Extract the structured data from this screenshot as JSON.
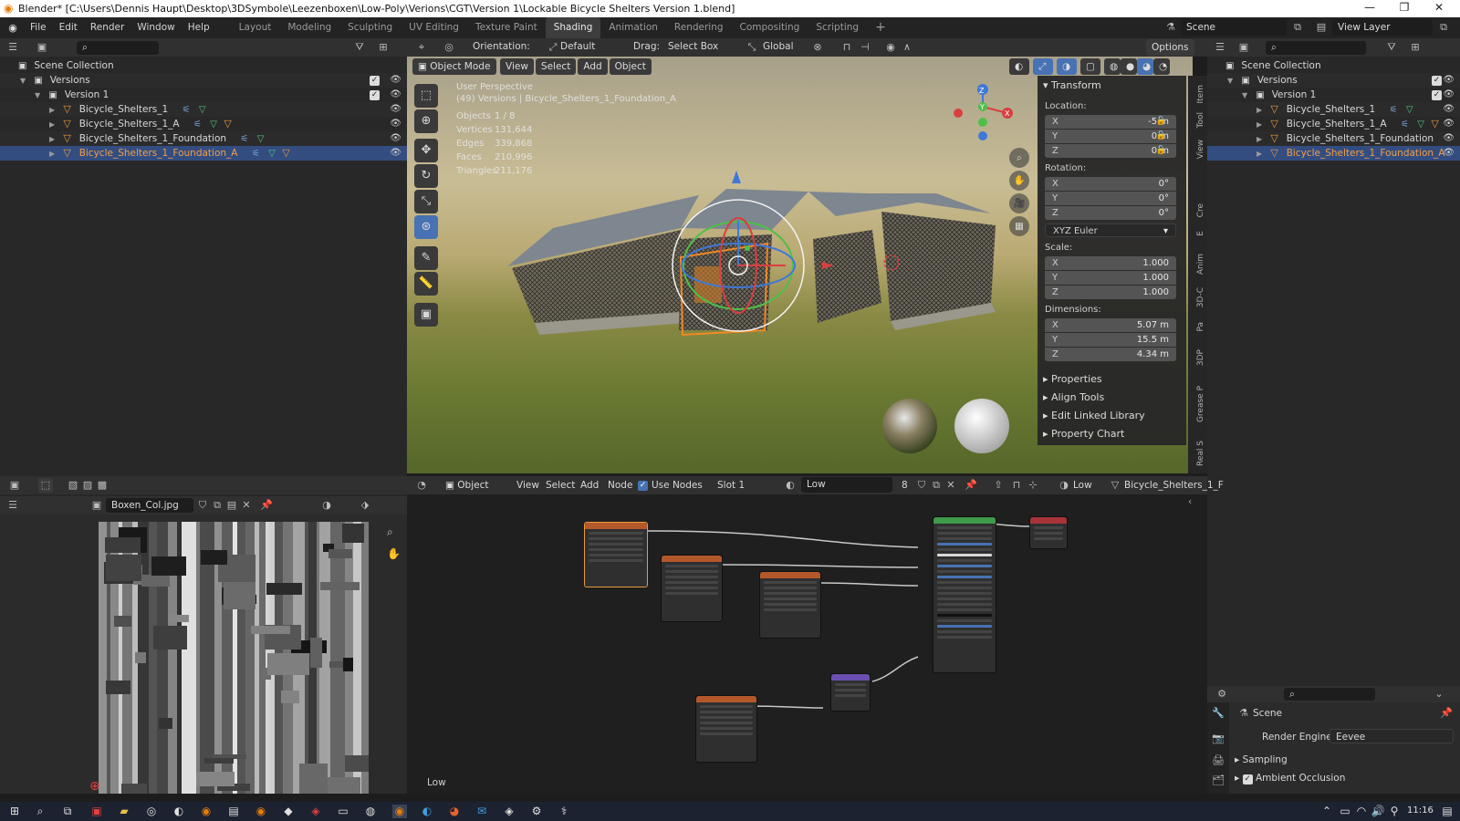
{
  "window": {
    "title": "Blender* [C:\\Users\\Dennis Haupt\\Desktop\\3DSymbole\\Leezenboxen\\Low-Poly\\Verions\\CGT\\Version 1\\Lockable Bicycle Shelters Version 1.blend]"
  },
  "menu": [
    "File",
    "Edit",
    "Render",
    "Window",
    "Help"
  ],
  "workspaces": [
    "Layout",
    "Modeling",
    "Sculpting",
    "UV Editing",
    "Texture Paint",
    "Shading",
    "Animation",
    "Rendering",
    "Compositing",
    "Scripting"
  ],
  "active_workspace": "Shading",
  "scene": {
    "name": "Scene",
    "view_layer": "View Layer"
  },
  "outliner": {
    "root": "Scene Collection",
    "rows": [
      {
        "label": "Versions"
      },
      {
        "label": "Version 1"
      },
      {
        "label": "Bicycle_Shelters_1"
      },
      {
        "label": "Bicycle_Shelters_1_A"
      },
      {
        "label": "Bicycle_Shelters_1_Foundation"
      },
      {
        "label": "Bicycle_Shelters_1_Foundation_A"
      }
    ]
  },
  "viewport_header": {
    "orientation_label": "Orientation:",
    "orientation_value": "Default",
    "drag_label": "Drag:",
    "drag_value": "Select Box",
    "transform_space": "Global",
    "options": "Options",
    "mode": "Object Mode",
    "menus": [
      "View",
      "Select",
      "Add",
      "Object"
    ]
  },
  "viewport_overlay": {
    "perspective": "User Perspective",
    "collection": "(49) Versions | Bicycle_Shelters_1_Foundation_A",
    "stats": [
      {
        "k": "Objects",
        "v": "1 / 8"
      },
      {
        "k": "Vertices",
        "v": "131,644"
      },
      {
        "k": "Edges",
        "v": "339,868"
      },
      {
        "k": "Faces",
        "v": "210,996"
      },
      {
        "k": "Triangles",
        "v": "211,176"
      }
    ]
  },
  "transform_panel": {
    "title": "Transform",
    "location_label": "Location:",
    "location": {
      "x": "-5 m",
      "y": "0 m",
      "z": "0 m"
    },
    "rotation_label": "Rotation:",
    "rotation": {
      "x": "0°",
      "y": "0°",
      "z": "0°"
    },
    "rotation_mode": "XYZ Euler",
    "scale_label": "Scale:",
    "scale": {
      "x": "1.000",
      "y": "1.000",
      "z": "1.000"
    },
    "dimensions_label": "Dimensions:",
    "dimensions": {
      "x": "5.07 m",
      "y": "15.5 m",
      "z": "4.34 m"
    },
    "sections": [
      "Properties",
      "Align Tools",
      "Edit Linked Library",
      "Property Chart"
    ],
    "side_tabs": [
      "Item",
      "Tool",
      "View",
      "Cre",
      "E",
      "Anim",
      "3D-C",
      "Pa",
      "3DP",
      "Grease P",
      "Real S"
    ],
    "axis_labels": {
      "x": "X",
      "y": "Y",
      "z": "Z"
    }
  },
  "node_editor": {
    "type": "Object",
    "menus": [
      "View",
      "Select",
      "Add",
      "Node"
    ],
    "use_nodes": "Use Nodes",
    "slot": "Slot 1",
    "material": "Low",
    "users": "8",
    "object": "Bicycle_Shelters_1_F",
    "quality": "Low",
    "footer_label": "Low"
  },
  "image_editor": {
    "image_name": "Boxen_Col.jpg"
  },
  "properties": {
    "scene_label": "Scene",
    "render_engine_label": "Render Engine",
    "render_engine": "Eevee",
    "sections": [
      "Sampling",
      "Ambient Occlusion"
    ]
  },
  "taskbar": {
    "time": "11:16"
  }
}
